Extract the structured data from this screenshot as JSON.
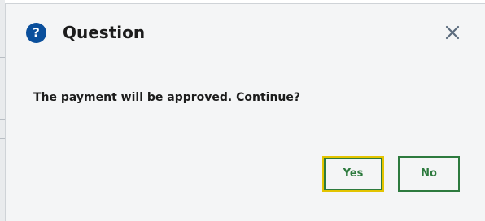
{
  "dialog": {
    "title": "Question",
    "help_icon_glyph": "?",
    "message": "The payment will be approved. Continue?",
    "buttons": {
      "yes": "Yes",
      "no": "No"
    },
    "close_icon": "close-icon"
  },
  "colors": {
    "accent_green": "#2d7a3e",
    "focus_yellow": "#e3c400",
    "help_blue": "#0a4f9c"
  }
}
